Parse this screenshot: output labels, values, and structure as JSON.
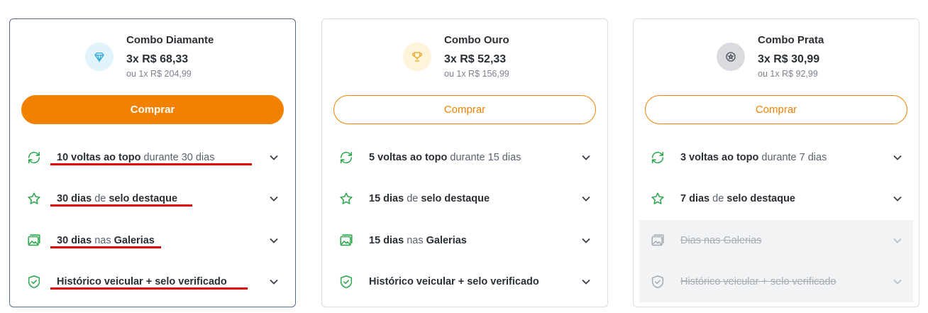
{
  "combos": [
    {
      "title": "Combo Diamante",
      "price": "3x R$ 68,33",
      "alt_price": "ou 1x R$ 204,99",
      "icon": "diamond-icon",
      "badge_color": "#e1f4fc",
      "icon_color": "#2fa7d8",
      "button": "Comprar",
      "button_style": "solid",
      "selected": true,
      "features": [
        {
          "icon": "refresh-icon",
          "strong": "10 voltas ao topo",
          "mid": " durante 30 dias",
          "strong2": "",
          "disabled": false
        },
        {
          "icon": "star-icon",
          "strong": "30 dias",
          "mid": " de ",
          "strong2": "selo destaque",
          "disabled": false
        },
        {
          "icon": "gallery-icon",
          "strong": "30 dias",
          "mid": " nas ",
          "strong2": "Galerias",
          "disabled": false
        },
        {
          "icon": "shield-check-icon",
          "strong": "Histórico veicular + selo verificado",
          "mid": "",
          "strong2": "",
          "disabled": false
        }
      ]
    },
    {
      "title": "Combo Ouro",
      "price": "3x R$ 52,33",
      "alt_price": "ou 1x R$ 156,99",
      "icon": "trophy-icon",
      "badge_color": "#fff3d9",
      "icon_color": "#e7a923",
      "button": "Comprar",
      "button_style": "outline",
      "selected": false,
      "features": [
        {
          "icon": "refresh-icon",
          "strong": "5 voltas ao topo",
          "mid": " durante 15 dias",
          "strong2": "",
          "disabled": false
        },
        {
          "icon": "star-icon",
          "strong": "15 dias",
          "mid": " de ",
          "strong2": "selo destaque",
          "disabled": false
        },
        {
          "icon": "gallery-icon",
          "strong": "15 dias",
          "mid": " nas ",
          "strong2": "Galerias",
          "disabled": false
        },
        {
          "icon": "shield-check-icon",
          "strong": "Histórico veicular + selo verificado",
          "mid": "",
          "strong2": "",
          "disabled": false
        }
      ]
    },
    {
      "title": "Combo Prata",
      "price": "3x R$ 30,99",
      "alt_price": "ou 1x R$ 92,99",
      "icon": "medal-icon",
      "badge_color": "#d9dbe0",
      "icon_color": "#4a4f58",
      "button": "Comprar",
      "button_style": "outline",
      "selected": false,
      "features": [
        {
          "icon": "refresh-icon",
          "strong": "3 voltas ao topo",
          "mid": " durante 7 dias",
          "strong2": "",
          "disabled": false
        },
        {
          "icon": "star-icon",
          "strong": "7 dias",
          "mid": " de ",
          "strong2": "selo destaque",
          "disabled": false
        },
        {
          "icon": "gallery-icon",
          "strong": "",
          "mid": "Dias nas Galerias",
          "strong2": "",
          "disabled": true
        },
        {
          "icon": "shield-check-icon",
          "strong": "",
          "mid": "Histórico veicular + selo verificado",
          "strong2": "",
          "disabled": true
        }
      ]
    }
  ],
  "colors": {
    "accent": "#f28100",
    "feature_icon": "#2ea84f",
    "annotation": "#e00000"
  }
}
